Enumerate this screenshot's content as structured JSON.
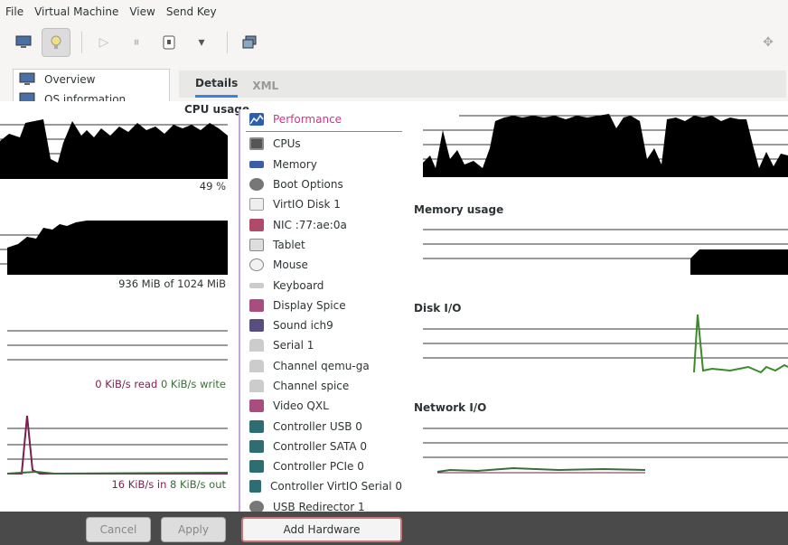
{
  "menu": [
    "File",
    "Virtual Machine",
    "View",
    "Send Key"
  ],
  "sidebar": {
    "items": [
      {
        "label": "Overview"
      },
      {
        "label": "OS information"
      }
    ]
  },
  "tabs": [
    {
      "label": "Details"
    },
    {
      "label": "XML"
    }
  ],
  "overview": {
    "cpu_title": "CPU usage",
    "cpu_value": "49 %",
    "memory_value": "936 MiB of 1024 MiB",
    "disk_read": "0 KiB/s read",
    "disk_write": "0 KiB/s write",
    "net_in": "16 KiB/s in",
    "net_out": "8 KiB/s out"
  },
  "graphs": {
    "memory_title": "Memory usage",
    "disk_title": "Disk I/O",
    "network_title": "Network I/O"
  },
  "hardware_menu": [
    {
      "label": "Performance",
      "icon": "performance-icon",
      "color": "#2b5fb0",
      "selected": true
    },
    {
      "label": "CPUs",
      "icon": "cpu-icon",
      "color": "#555555"
    },
    {
      "label": "Memory",
      "icon": "memory-icon",
      "color": "#3a5fa8"
    },
    {
      "label": "Boot Options",
      "icon": "boot-options-icon",
      "color": "#777777"
    },
    {
      "label": "VirtIO Disk 1",
      "icon": "disk-icon",
      "color": "#cccccc"
    },
    {
      "label": "NIC :77:ae:0a",
      "icon": "nic-icon",
      "color": "#b04a6b"
    },
    {
      "label": "Tablet",
      "icon": "tablet-icon",
      "color": "#aaaaaa"
    },
    {
      "label": "Mouse",
      "icon": "mouse-icon",
      "color": "#dddddd"
    },
    {
      "label": "Keyboard",
      "icon": "keyboard-icon",
      "color": "#bbbbbb"
    },
    {
      "label": "Display Spice",
      "icon": "display-icon",
      "color": "#a84d7f"
    },
    {
      "label": "Sound ich9",
      "icon": "sound-icon",
      "color": "#5a4d7f"
    },
    {
      "label": "Serial 1",
      "icon": "serial-icon",
      "color": "#aaaaaa"
    },
    {
      "label": "Channel qemu-ga",
      "icon": "channel-icon",
      "color": "#aaaaaa"
    },
    {
      "label": "Channel spice",
      "icon": "channel-icon",
      "color": "#aaaaaa"
    },
    {
      "label": "Video QXL",
      "icon": "video-icon",
      "color": "#a84d7f"
    },
    {
      "label": "Controller USB 0",
      "icon": "controller-icon",
      "color": "#2e6e72"
    },
    {
      "label": "Controller SATA 0",
      "icon": "controller-icon",
      "color": "#2e6e72"
    },
    {
      "label": "Controller PCIe 0",
      "icon": "controller-icon",
      "color": "#2e6e72"
    },
    {
      "label": "Controller VirtIO Serial 0",
      "icon": "controller-icon",
      "color": "#2e6e72"
    },
    {
      "label": "USB Redirector 1",
      "icon": "usb-redirector-icon",
      "color": "#777777"
    }
  ],
  "buttons": {
    "cancel": "Cancel",
    "apply": "Apply",
    "add_hardware": "Add Hardware"
  },
  "colors": {
    "accent": "#3584e4",
    "disk_read": "#7a1f4e",
    "disk_write": "#3a6e3a",
    "net_in": "#7a1f4e",
    "net_out": "#3a6e3a"
  }
}
